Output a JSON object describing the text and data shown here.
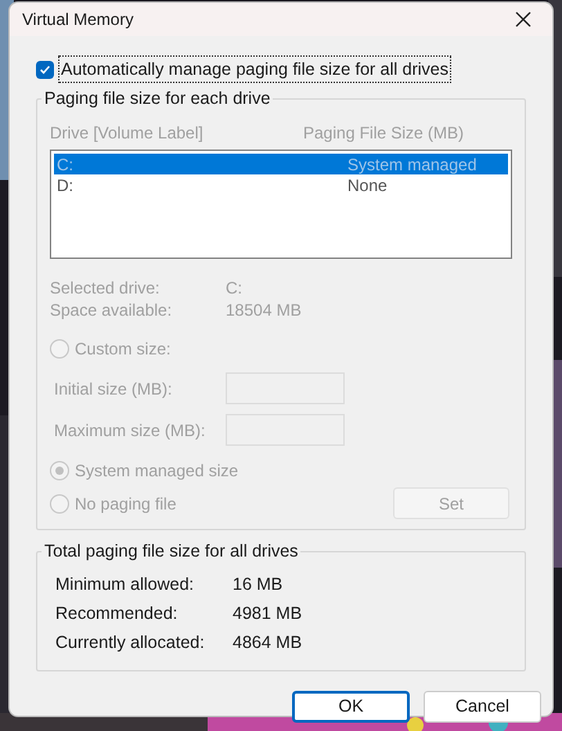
{
  "window": {
    "title": "Virtual Memory"
  },
  "auto_manage": {
    "label": "Automatically manage paging file size for all drives",
    "checked": true
  },
  "drives_group": {
    "title": "Paging file size for each drive",
    "disabled": true,
    "columns": [
      "Drive [Volume Label]",
      "Paging File Size (MB)"
    ],
    "rows": [
      {
        "drive": "C:",
        "size": "System managed",
        "selected": true
      },
      {
        "drive": "D:",
        "size": "None",
        "selected": false
      }
    ],
    "info": [
      {
        "label": "Selected drive:",
        "value": "C:"
      },
      {
        "label": "Space available:",
        "value": "18504 MB"
      }
    ],
    "options": [
      {
        "kind": "radio",
        "label": "Custom size:",
        "selected": false
      },
      {
        "kind": "field",
        "label": "Initial size (MB):"
      },
      {
        "kind": "field",
        "label": "Maximum size (MB):"
      },
      {
        "kind": "radio",
        "label": "System managed size",
        "selected": true
      },
      {
        "kind": "radio",
        "label": "No paging file",
        "selected": false
      }
    ],
    "set_button": "Set"
  },
  "totals_group": {
    "title": "Total paging file size for all drives",
    "rows": [
      {
        "label": "Minimum allowed:",
        "value": "16 MB"
      },
      {
        "label": "Recommended:",
        "value": "4981 MB"
      },
      {
        "label": "Currently allocated:",
        "value": "4864 MB"
      }
    ]
  },
  "buttons": [
    {
      "label": "OK",
      "default": true
    },
    {
      "label": "Cancel",
      "default": false
    }
  ]
}
